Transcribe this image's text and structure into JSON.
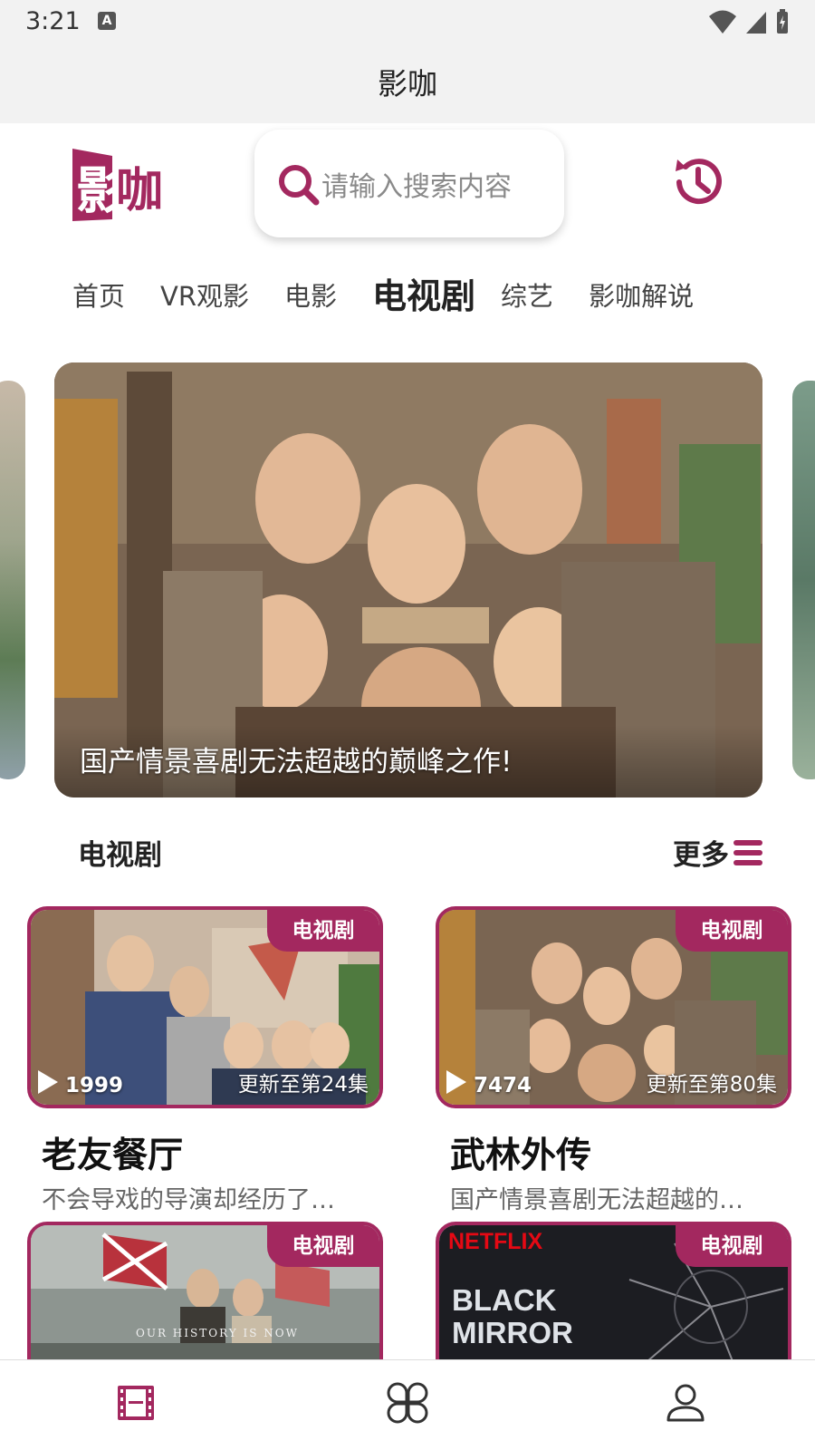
{
  "status_bar": {
    "time": "3:21",
    "notification_icon": "A"
  },
  "app_bar": {
    "title": "影咖"
  },
  "header": {
    "logo_text": "影咖",
    "search_placeholder": "请输入搜索内容"
  },
  "tabs": [
    {
      "label": "首页",
      "active": false
    },
    {
      "label": "VR观影",
      "active": false
    },
    {
      "label": "电影",
      "active": false
    },
    {
      "label": "电视剧",
      "active": true
    },
    {
      "label": "综艺",
      "active": false
    },
    {
      "label": "影咖解说",
      "active": false
    }
  ],
  "banner": {
    "caption": "国产情景喜剧无法超越的巅峰之作!"
  },
  "section": {
    "title": "电视剧",
    "more_label": "更多"
  },
  "cards": [
    {
      "badge": "电视剧",
      "views": "1999",
      "update": "更新至第24集",
      "title": "老友餐厅",
      "desc": "不会导戏的导演却经历了…"
    },
    {
      "badge": "电视剧",
      "views": "7474",
      "update": "更新至第80集",
      "title": "武林外传",
      "desc": "国产情景喜剧无法超越的…"
    },
    {
      "badge": "电视剧",
      "poster_text": "OUR HISTORY IS NOW"
    },
    {
      "badge": "电视剧",
      "poster_brand": "NETFLIX",
      "poster_title_1": "BLACK",
      "poster_title_2": "MIRROR"
    }
  ],
  "colors": {
    "brand": "#a3285f",
    "tab_active": "#222222",
    "background": "#ffffff",
    "header_bg": "#f2f2f2"
  },
  "bottom_nav": [
    {
      "icon": "film-icon",
      "active": true
    },
    {
      "icon": "grid-icon",
      "active": false
    },
    {
      "icon": "user-icon",
      "active": false
    }
  ]
}
